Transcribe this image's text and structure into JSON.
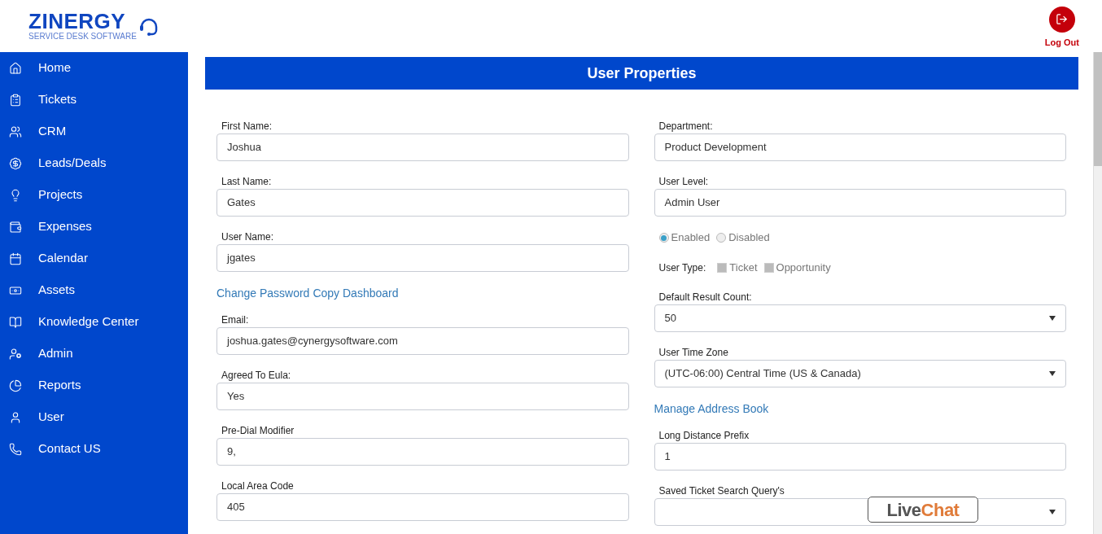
{
  "logo": {
    "name": "ZINERGY",
    "tagline": "SERVICE DESK SOFTWARE"
  },
  "logout": {
    "label": "Log Out"
  },
  "sidebar": {
    "items": [
      {
        "label": "Home"
      },
      {
        "label": "Tickets"
      },
      {
        "label": "CRM"
      },
      {
        "label": "Leads/Deals"
      },
      {
        "label": "Projects"
      },
      {
        "label": "Expenses"
      },
      {
        "label": "Calendar"
      },
      {
        "label": "Assets"
      },
      {
        "label": "Knowledge Center"
      },
      {
        "label": "Admin"
      },
      {
        "label": "Reports"
      },
      {
        "label": "User"
      },
      {
        "label": "Contact US"
      }
    ]
  },
  "page_title": "User Properties",
  "left_column": [
    {
      "kind": "field",
      "label": "First Name:",
      "value": "Joshua"
    },
    {
      "kind": "field",
      "label": "Last Name:",
      "value": "Gates"
    },
    {
      "kind": "field",
      "label": "User Name:",
      "value": "jgates"
    },
    {
      "kind": "links",
      "links": [
        "Change Password",
        "Copy Dashboard"
      ]
    },
    {
      "kind": "field",
      "label": "Email:",
      "value": "joshua.gates@cynergysoftware.com"
    },
    {
      "kind": "field",
      "label": "Agreed To Eula:",
      "value": "Yes"
    },
    {
      "kind": "field",
      "label": "Pre-Dial Modifier",
      "value": "9,"
    },
    {
      "kind": "field",
      "label": "Local Area Code",
      "value": "405"
    }
  ],
  "right_column": [
    {
      "kind": "field",
      "label": "Department:",
      "value": "Product Development"
    },
    {
      "kind": "field",
      "label": "User Level:",
      "value": "Admin User"
    },
    {
      "kind": "radios",
      "options": [
        {
          "label": "Enabled",
          "selected": true
        },
        {
          "label": "Disabled",
          "selected": false
        }
      ]
    },
    {
      "kind": "checkboxes",
      "label": "User Type:",
      "options": [
        {
          "label": "Ticket",
          "checked": false
        },
        {
          "label": "Opportunity",
          "checked": false
        }
      ]
    },
    {
      "kind": "select",
      "label": "Default Result Count:",
      "value": "50"
    },
    {
      "kind": "select",
      "label": "User Time Zone",
      "value": "(UTC-06:00) Central Time (US & Canada)"
    },
    {
      "kind": "link",
      "label": "Manage Address Book"
    },
    {
      "kind": "field",
      "label": "Long Distance Prefix",
      "value": "1"
    },
    {
      "kind": "select",
      "label": "Saved Ticket Search Query's"
    }
  ],
  "livechat": {
    "part_1": "Live",
    "part_2": "Chat"
  }
}
